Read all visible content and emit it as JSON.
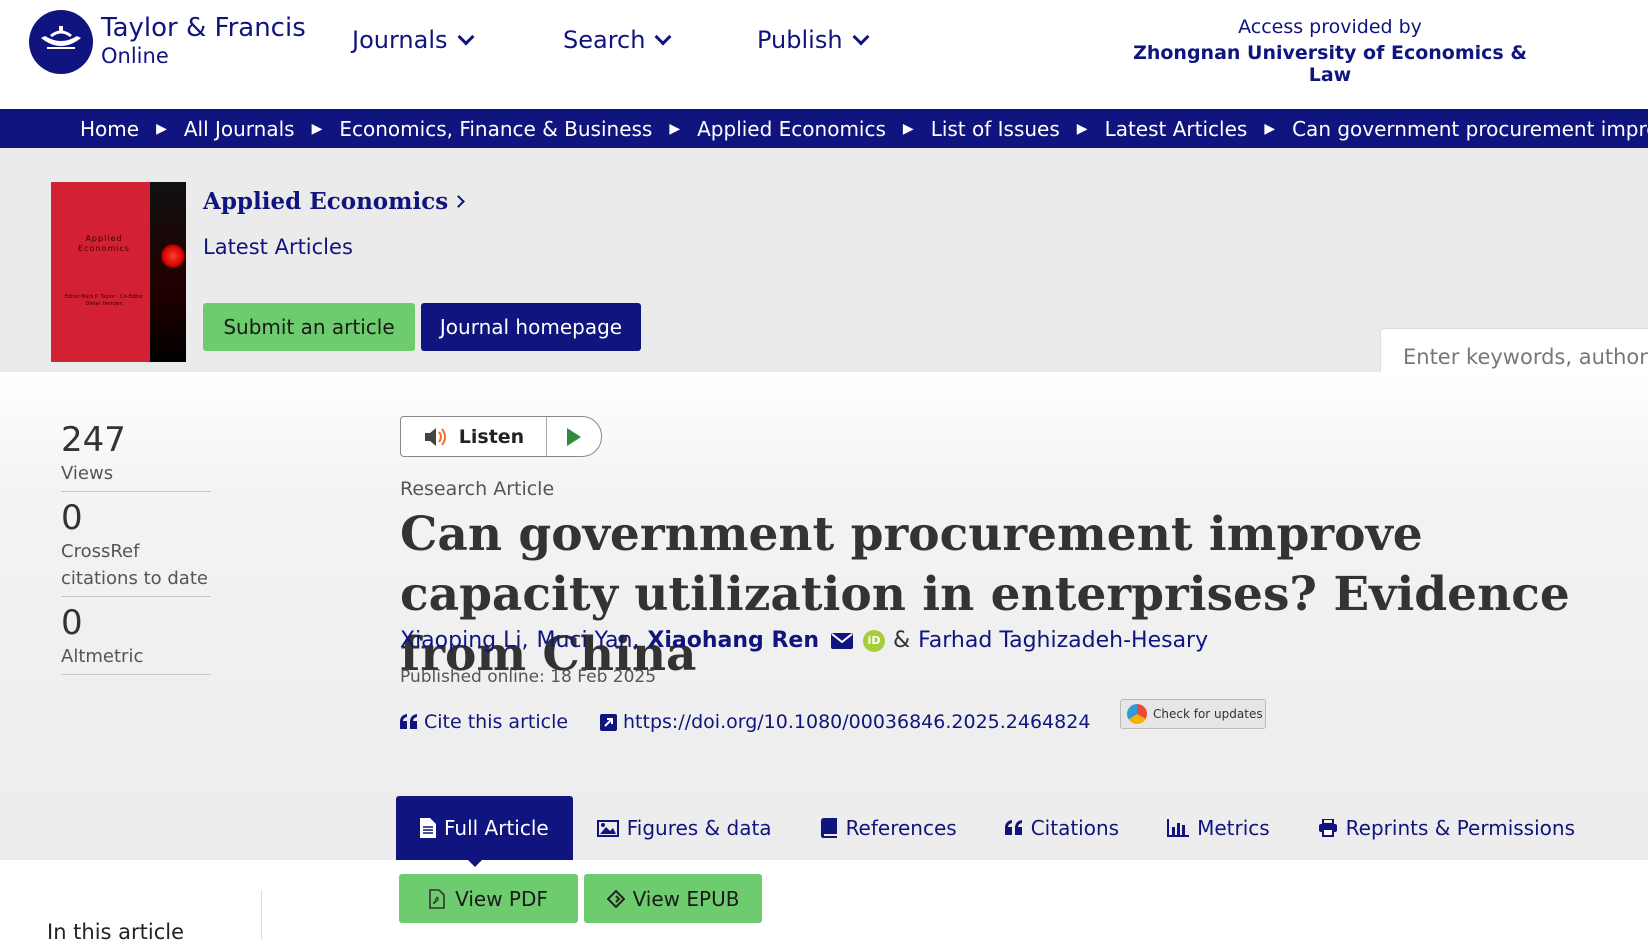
{
  "header": {
    "logo_line1": "Taylor & Francis",
    "logo_line2": "Online",
    "nav": [
      {
        "label": "Journals"
      },
      {
        "label": "Search"
      },
      {
        "label": "Publish"
      }
    ],
    "access_label": "Access provided by",
    "access_institution": "Zhongnan University of Economics & Law"
  },
  "breadcrumb": [
    "Home",
    "All Journals",
    "Economics, Finance & Business",
    "Applied Economics",
    "List of Issues",
    "Latest Articles",
    "Can government procurement improve capacity utilization in enterprises? Evidence from China"
  ],
  "journal": {
    "title": "Applied Economics",
    "subtitle": "Latest Articles",
    "submit_label": "Submit an article",
    "homepage_label": "Journal homepage",
    "cover_title": "Applied Economics",
    "cover_editors": "Editor Mark P. Taylor · Co-Editor Dieter Heinzen"
  },
  "search": {
    "placeholder": "Enter keywords, authors, DOI, ORCID etc"
  },
  "metrics": [
    {
      "value": "247",
      "label": "Views"
    },
    {
      "value": "0",
      "label": "CrossRef citations to date"
    },
    {
      "value": "0",
      "label": "Altmetric"
    }
  ],
  "listen": {
    "label": "Listen"
  },
  "article": {
    "type": "Research Article",
    "title": "Can government procurement improve capacity utilization in enterprises? Evidence from China",
    "authors": [
      "Xiaoping Li,",
      "Muci Yan,",
      "Xiaohang Ren",
      "Farhad Taghizadeh-Hesary"
    ],
    "amp": "&",
    "orcid_icon": "iD",
    "published": "Published online: 18 Feb 2025",
    "cite_label": "Cite this article",
    "doi": "https://doi.org/10.1080/00036846.2025.2464824",
    "updates_label": "Check for updates"
  },
  "tabs": [
    {
      "label": "Full Article",
      "icon": "document-icon"
    },
    {
      "label": "Figures & data",
      "icon": "image-icon"
    },
    {
      "label": "References",
      "icon": "book-icon"
    },
    {
      "label": "Citations",
      "icon": "quote-icon"
    },
    {
      "label": "Metrics",
      "icon": "bar-chart-icon"
    },
    {
      "label": "Reprints & Permissions",
      "icon": "print-icon"
    }
  ],
  "actions": {
    "pdf_label": "View PDF",
    "epub_label": "View EPUB"
  },
  "sidebar": {
    "in_this_article": "In this article"
  },
  "colors": {
    "brand_navy": "#10147e",
    "green_button": "#6dcc6e",
    "band_gray": "#ebebeb"
  }
}
